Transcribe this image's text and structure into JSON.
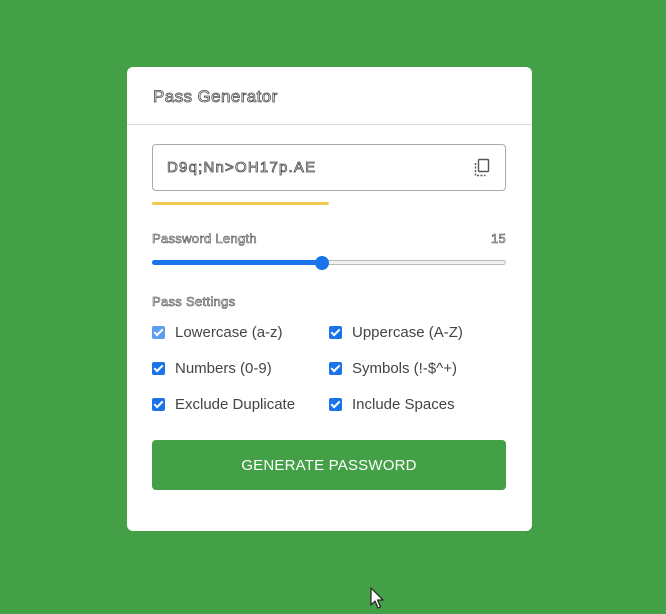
{
  "card": {
    "title": "Pass Generator",
    "password": "D9q;Nn>OH17p.AE",
    "copy_icon": "copy-icon",
    "strength_fraction": 0.5,
    "length_label": "Password Length",
    "length_value": "15",
    "length_slider_fraction": 0.48,
    "settings_label": "Pass Settings",
    "options": [
      {
        "label": "Lowercase (a-z)",
        "checked": true
      },
      {
        "label": "Uppercase (A-Z)",
        "checked": true
      },
      {
        "label": "Numbers (0-9)",
        "checked": true
      },
      {
        "label": "Symbols (!-$^+)",
        "checked": true
      },
      {
        "label": "Exclude Duplicate",
        "checked": true
      },
      {
        "label": "Include Spaces",
        "checked": true
      }
    ],
    "generate_label": "GENERATE PASSWORD"
  },
  "colors": {
    "background": "#43a047",
    "accent": "#1a73e8",
    "strength": "#f2c94c",
    "button": "#43a047"
  }
}
